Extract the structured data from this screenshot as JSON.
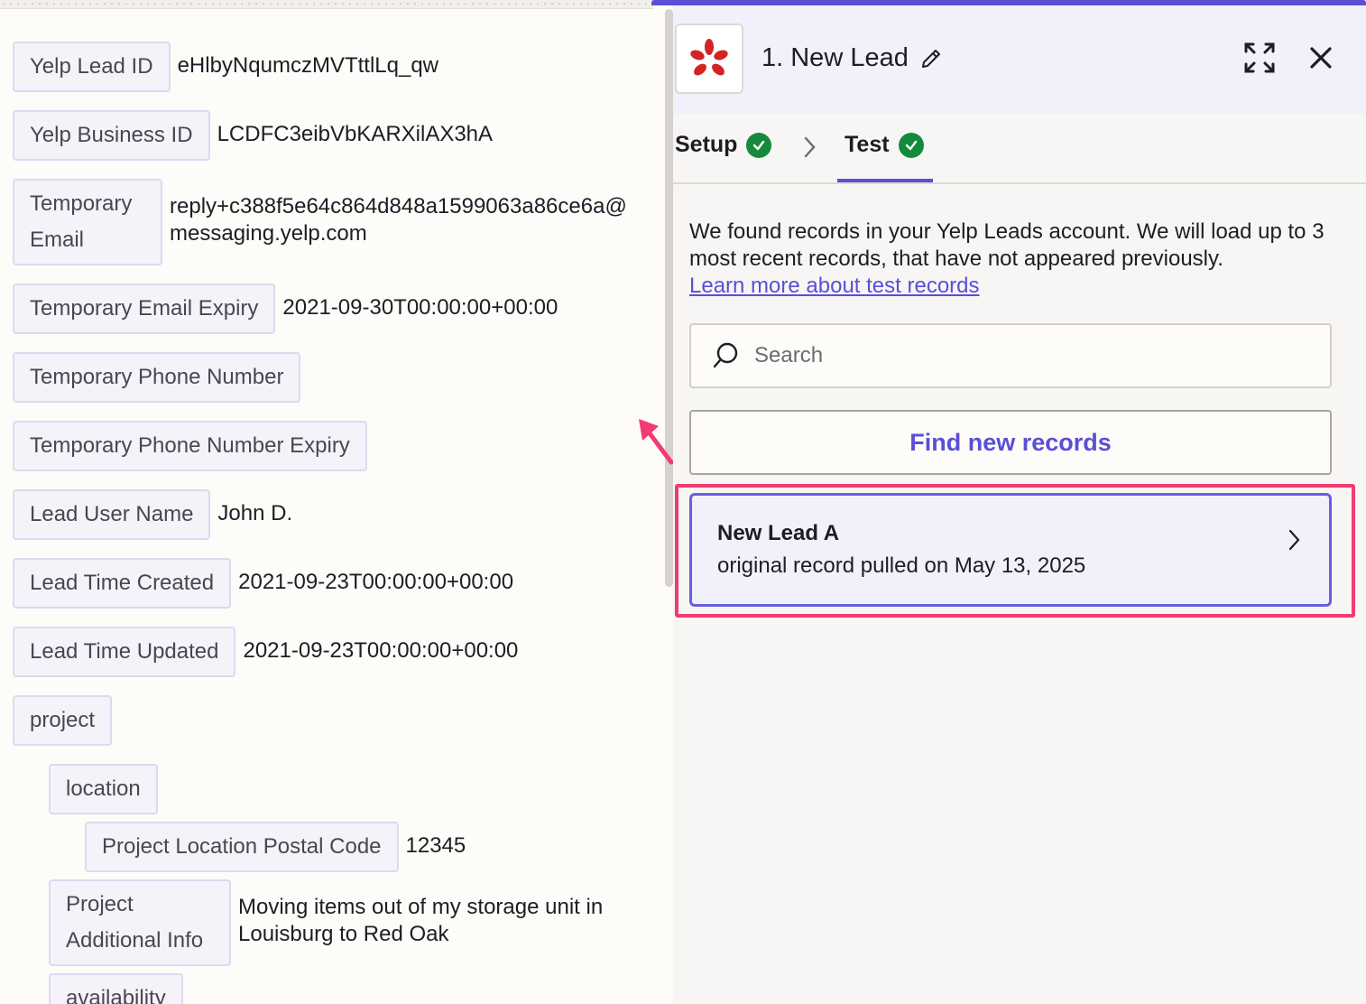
{
  "colors": {
    "accent": "#5a4fd6",
    "highlight": "#f23a75",
    "success": "#138a3c",
    "yelp_red": "#d32323"
  },
  "left_panel": {
    "fields": [
      {
        "label": "Yelp Lead ID",
        "value": "eHlbyNqumczMVTttlLq_qw"
      },
      {
        "label": "Yelp Business ID",
        "value": "LCDFC3eibVbKARXilAX3hA"
      },
      {
        "label": "Temporary Email",
        "value": "reply+c388f5e64c864d848a1599063a86ce6a@messaging.yelp.com"
      },
      {
        "label": "Temporary Email Expiry",
        "value": "2021-09-30T00:00:00+00:00"
      },
      {
        "label": "Temporary Phone Number",
        "value": ""
      },
      {
        "label": "Temporary Phone Number Expiry",
        "value": ""
      },
      {
        "label": "Lead User Name",
        "value": "John D."
      },
      {
        "label": "Lead Time Created",
        "value": "2021-09-23T00:00:00+00:00"
      },
      {
        "label": "Lead Time Updated",
        "value": "2021-09-23T00:00:00+00:00"
      },
      {
        "label": "project",
        "value": ""
      },
      {
        "label": "location",
        "value": ""
      },
      {
        "label": "Project Location Postal Code",
        "value": "12345"
      },
      {
        "label": "Project Additional Info",
        "value": "Moving items out of my storage unit in Louisburg to Red Oak"
      },
      {
        "label": "availability",
        "value": ""
      }
    ]
  },
  "right_panel": {
    "step_title": "1. New Lead",
    "app_icon": "yelp-logo-icon",
    "tabs": [
      {
        "label": "Setup",
        "status": "complete"
      },
      {
        "label": "Test",
        "status": "complete",
        "active": true
      }
    ],
    "description": "We found records in your Yelp Leads account. We will load up to 3 most recent records, that have not appeared previously.",
    "learn_more_link": "Learn more about test records",
    "search": {
      "placeholder": "Search",
      "value": ""
    },
    "find_button": "Find new records",
    "records": [
      {
        "title": "New Lead A",
        "subtitle": "original record pulled on May 13, 2025"
      }
    ]
  }
}
